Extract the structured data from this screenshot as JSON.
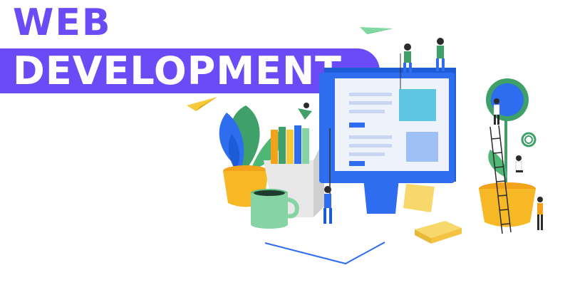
{
  "banner": {
    "title_line1": "WEB",
    "title_line2": "DEVELOPMENT"
  },
  "colors": {
    "brand_purple": "#6b4bf5",
    "monitor_blue": "#2f6df0",
    "screen_light": "#eef2fb",
    "plant_green": "#3fa06a",
    "pot_yellow": "#f6b824",
    "mug_green": "#86d4a3",
    "paper_yellow": "#f7d96b"
  }
}
